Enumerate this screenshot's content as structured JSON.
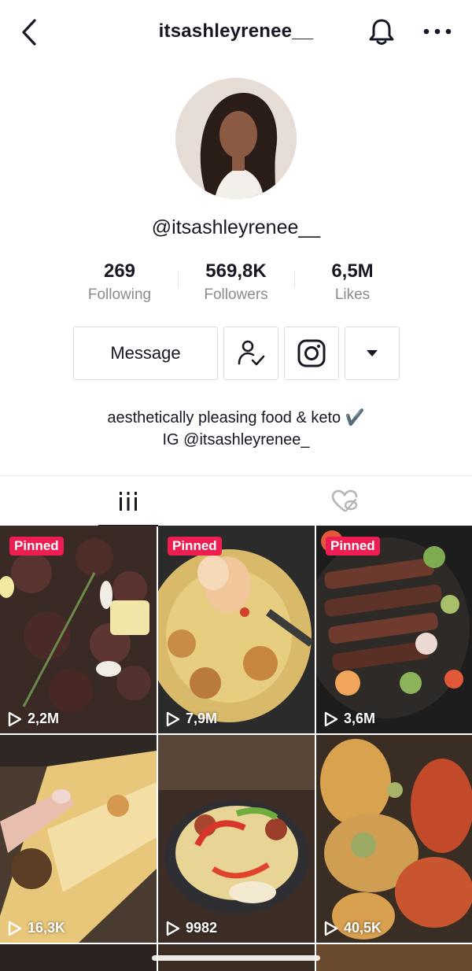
{
  "header": {
    "title": "itsashleyrenee__",
    "back_icon": "chevron-left-icon",
    "bell_icon": "bell-icon",
    "more_icon": "more-horizontal-icon"
  },
  "profile": {
    "handle": "@itsashleyrenee__",
    "stats": [
      {
        "value": "269",
        "label": "Following"
      },
      {
        "value": "569,8K",
        "label": "Followers"
      },
      {
        "value": "6,5M",
        "label": "Likes"
      }
    ],
    "message_label": "Message",
    "bio_line1": "aesthetically pleasing food & keto ✔️",
    "bio_line2": "IG @itsashleyrenee_"
  },
  "tabs": {
    "videos_icon": "grid-bars-icon",
    "liked_icon": "hidden-heart-icon"
  },
  "videos": [
    {
      "views": "2,2M",
      "pinned": "Pinned"
    },
    {
      "views": "7,9M",
      "pinned": "Pinned"
    },
    {
      "views": "3,6M",
      "pinned": "Pinned"
    },
    {
      "views": "16,3K"
    },
    {
      "views": "9982"
    },
    {
      "views": "40,5K"
    }
  ],
  "colors": {
    "text": "#161823",
    "muted": "#8a8b91",
    "pinned_badge": "#ee1d52",
    "border": "#dcdcde"
  }
}
